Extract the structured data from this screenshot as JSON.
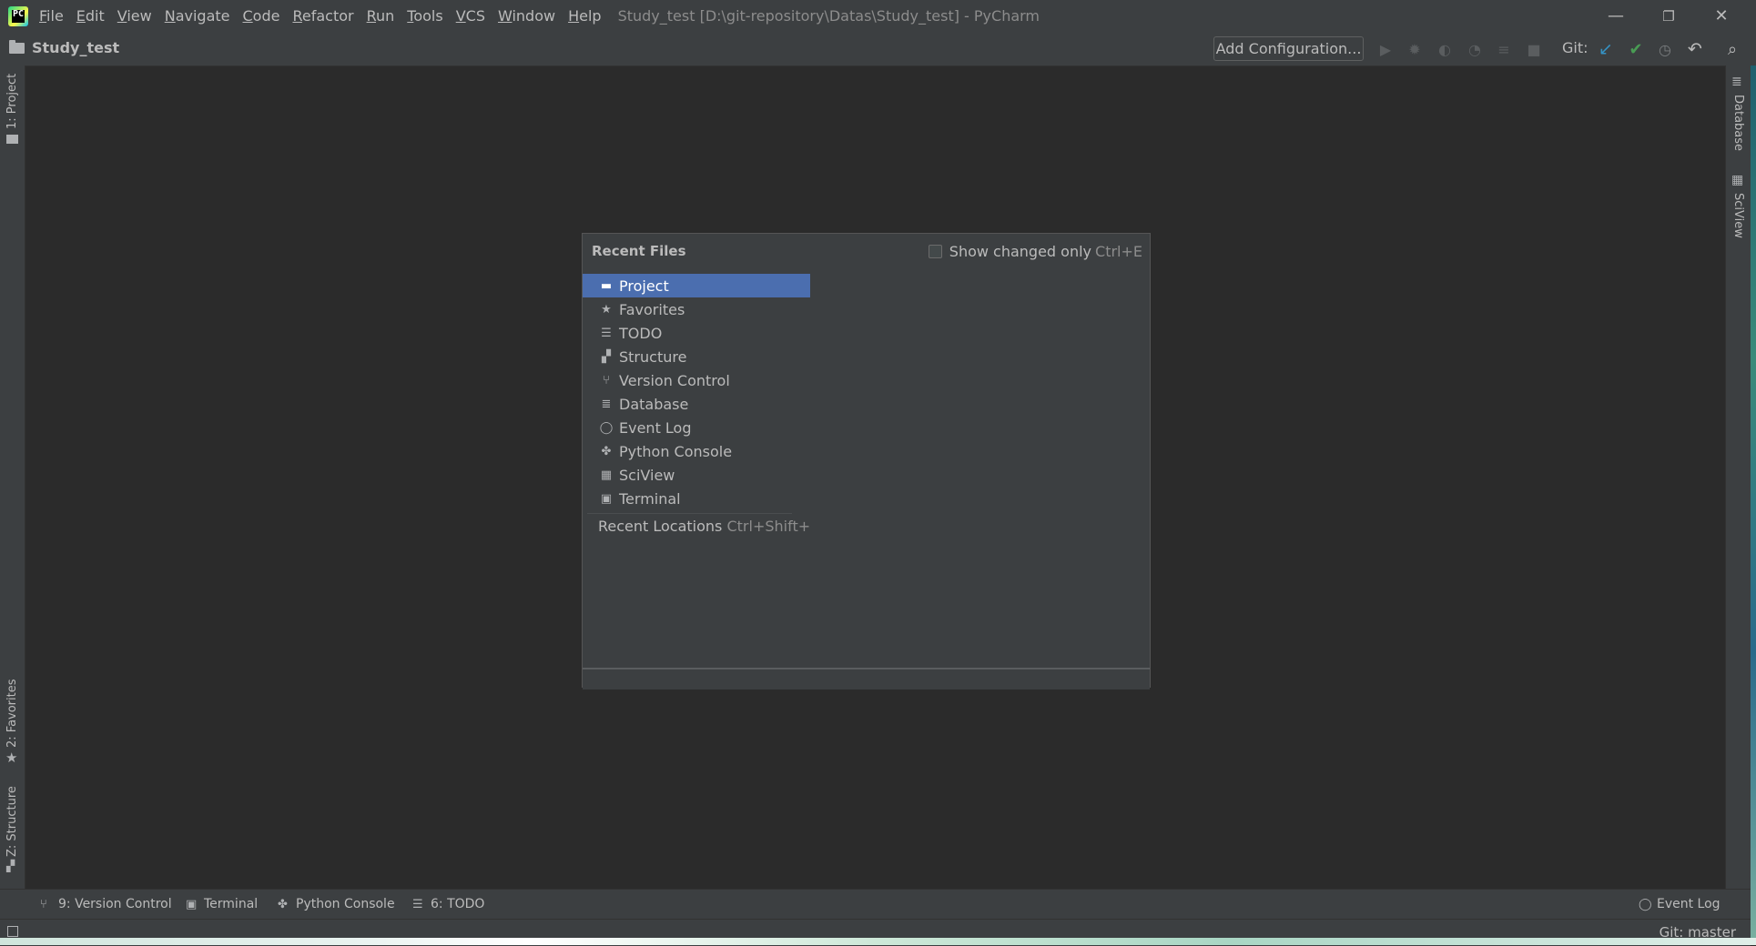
{
  "titlebar": {
    "menu": [
      "File",
      "Edit",
      "View",
      "Navigate",
      "Code",
      "Refactor",
      "Run",
      "Tools",
      "VCS",
      "Window",
      "Help"
    ],
    "window_title": "Study_test [D:\\git-repository\\Datas\\Study_test] - PyCharm",
    "minimize": "—",
    "restore": "❐",
    "close": "✕"
  },
  "navbar": {
    "project_name": "Study_test",
    "add_configuration": "Add Configuration...",
    "git_label": "Git:"
  },
  "left_stripe": {
    "project": "1: Project",
    "favorites": "2: Favorites",
    "structure": "Z: Structure"
  },
  "right_stripe": {
    "database": "Database",
    "sciview": "SciView"
  },
  "popup": {
    "title": "Recent Files",
    "show_changed_label": "Show changed only",
    "show_changed_shortcut": "Ctrl+E",
    "items": [
      {
        "label": "Project",
        "icon": "folder-icon",
        "glyph": "▬"
      },
      {
        "label": "Favorites",
        "icon": "star-icon",
        "glyph": "★"
      },
      {
        "label": "TODO",
        "icon": "list-icon",
        "glyph": "☰"
      },
      {
        "label": "Structure",
        "icon": "structure-icon",
        "glyph": "▞"
      },
      {
        "label": "Version Control",
        "icon": "branch-icon",
        "glyph": "⑂"
      },
      {
        "label": "Database",
        "icon": "database-icon",
        "glyph": "≣"
      },
      {
        "label": "Event Log",
        "icon": "speech-bubble-icon",
        "glyph": "◯"
      },
      {
        "label": "Python Console",
        "icon": "python-icon",
        "glyph": "✤"
      },
      {
        "label": "SciView",
        "icon": "grid-icon",
        "glyph": "▦"
      },
      {
        "label": "Terminal",
        "icon": "terminal-icon",
        "glyph": "▣"
      }
    ],
    "recent_locations_label": "Recent Locations",
    "recent_locations_shortcut": "Ctrl+Shift+"
  },
  "bottom_tools": {
    "version_control": "9: Version Control",
    "terminal": "Terminal",
    "python_console": "Python Console",
    "todo": "6: TODO",
    "event_log": "Event Log"
  },
  "status": {
    "git_branch": "Git: master"
  },
  "colors": {
    "selection": "#4b6eaf",
    "background": "#2b2b2b",
    "panel": "#3c3f41",
    "git_update": "#3592c4",
    "git_commit": "#499c54"
  }
}
